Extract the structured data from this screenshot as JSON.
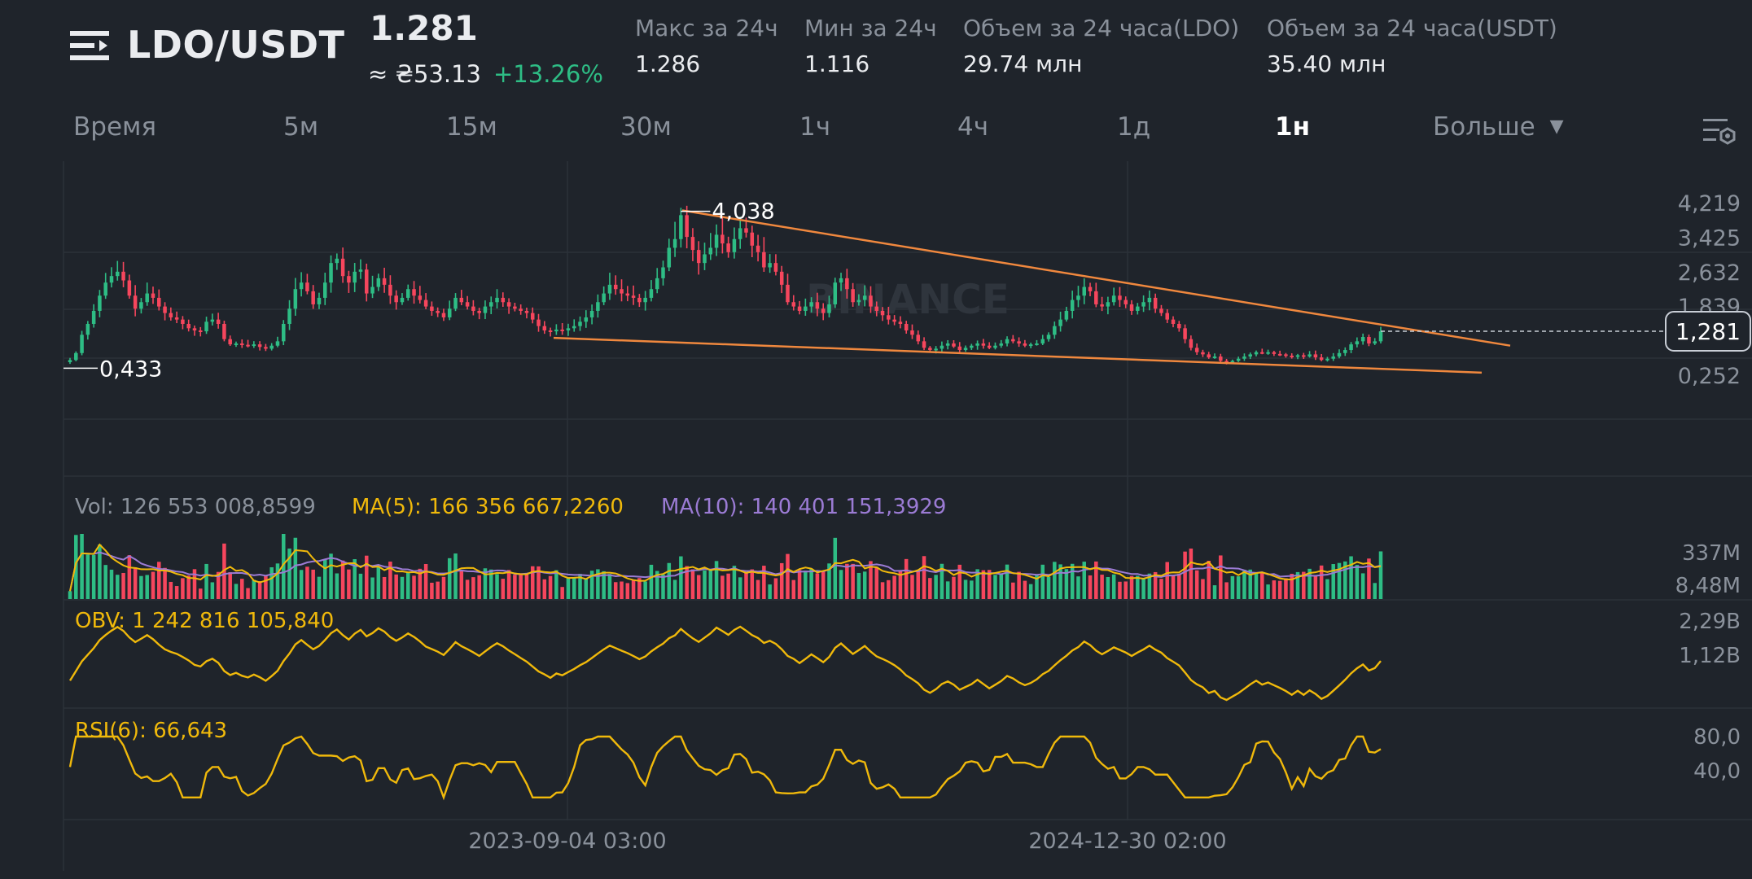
{
  "header": {
    "pair": "LDO/USDT",
    "price": "1.281",
    "fiat_price": "≈ ₴53.13",
    "change": "+13.26%",
    "stats": [
      {
        "label": "Макс за 24ч",
        "value": "1.286"
      },
      {
        "label": "Мин за 24ч",
        "value": "1.116"
      },
      {
        "label": "Объем за 24 часа(LDO)",
        "value": "29.74 млн"
      },
      {
        "label": "Объем за 24 часа(USDT)",
        "value": "35.40 млн"
      }
    ]
  },
  "tabs": {
    "items": [
      "Время",
      "5м",
      "15м",
      "30м",
      "1ч",
      "4ч",
      "1д",
      "1н"
    ],
    "active": "1н",
    "more": "Больше"
  },
  "colors": {
    "up": "#2ebd85",
    "down": "#f6465d",
    "trendline": "#f0883e",
    "ma5": "#f0b90b",
    "ma10": "#9b7bd4",
    "obv": "#f0b90b",
    "rsi": "#f0b90b",
    "background": "#1f242b"
  },
  "chart_data": [
    {
      "type": "candlestick",
      "price_axis_ticks": [
        "4,219",
        "3,425",
        "2,632",
        "1,839",
        "1,281",
        "0,252"
      ],
      "current_price_label": "1,281",
      "max_label": "4,038",
      "min_label": "0,433",
      "watermark": "BINANCE",
      "x_tick_labels": [
        "2023-09-04 03:00",
        "2024-12-30 02:00"
      ],
      "ylim": [
        0.252,
        4.219
      ],
      "trendlines": [
        {
          "name": "upper",
          "from_price": 4.06,
          "to_price": 0.95
        },
        {
          "name": "lower",
          "from_price": 1.13,
          "to_price": 0.33
        }
      ],
      "close": [
        0.62,
        0.78,
        1.2,
        1.45,
        1.75,
        2.1,
        2.4,
        2.55,
        2.65,
        2.45,
        2.1,
        1.8,
        1.95,
        2.15,
        2.05,
        1.85,
        1.7,
        1.6,
        1.55,
        1.45,
        1.35,
        1.3,
        1.28,
        1.5,
        1.55,
        1.45,
        1.1,
        0.98,
        1.0,
        0.97,
        0.96,
        0.98,
        0.92,
        0.88,
        0.95,
        1.05,
        1.45,
        1.8,
        2.25,
        2.4,
        2.2,
        1.9,
        2.05,
        2.4,
        2.85,
        2.95,
        2.55,
        2.4,
        2.65,
        2.7,
        2.15,
        2.3,
        2.5,
        2.35,
        2.1,
        1.95,
        2.05,
        2.25,
        2.1,
        2.0,
        1.85,
        1.75,
        1.7,
        1.6,
        1.8,
        2.05,
        1.95,
        1.85,
        1.75,
        1.7,
        1.85,
        1.95,
        2.05,
        1.95,
        1.85,
        1.8,
        1.75,
        1.7,
        1.55,
        1.4,
        1.3,
        1.28,
        1.32,
        1.3,
        1.35,
        1.4,
        1.5,
        1.6,
        1.75,
        1.95,
        2.15,
        2.35,
        2.25,
        2.15,
        2.1,
        2.05,
        1.95,
        2.05,
        2.25,
        2.5,
        2.75,
        3.2,
        3.4,
        3.95,
        3.45,
        3.15,
        2.85,
        3.05,
        3.2,
        3.5,
        3.3,
        3.1,
        3.4,
        3.65,
        3.55,
        3.25,
        3.1,
        2.75,
        2.85,
        2.65,
        2.35,
        1.95,
        1.85,
        1.75,
        1.85,
        1.95,
        1.8,
        1.7,
        1.9,
        2.4,
        2.5,
        2.25,
        1.95,
        2.0,
        2.1,
        1.85,
        1.75,
        1.65,
        1.55,
        1.5,
        1.45,
        1.3,
        1.2,
        1.05,
        0.9,
        0.85,
        0.88,
        0.95,
        1.0,
        0.93,
        0.85,
        0.9,
        0.95,
        1.0,
        0.95,
        0.9,
        0.95,
        1.0,
        1.1,
        1.05,
        1.0,
        0.95,
        0.98,
        1.0,
        1.1,
        1.2,
        1.4,
        1.55,
        1.75,
        2.0,
        2.1,
        2.3,
        2.2,
        1.9,
        1.85,
        1.95,
        2.1,
        2.0,
        1.9,
        1.75,
        1.85,
        1.95,
        2.05,
        1.8,
        1.7,
        1.55,
        1.45,
        1.35,
        1.1,
        0.9,
        0.8,
        0.75,
        0.68,
        0.7,
        0.6,
        0.57,
        0.6,
        0.65,
        0.7,
        0.75,
        0.8,
        0.78,
        0.8,
        0.76,
        0.75,
        0.72,
        0.7,
        0.73,
        0.7,
        0.75,
        0.68,
        0.62,
        0.65,
        0.7,
        0.78,
        0.85,
        0.98,
        1.05,
        1.15,
        1.0,
        1.05,
        1.28
      ]
    },
    {
      "type": "bar",
      "name": "Volume",
      "title": "Vol: 126 553 008,8599",
      "ma_labels": [
        "MA(5): 166 356 667,2260",
        "MA(10): 140 401 151,3929"
      ],
      "axis_ticks": [
        "337M",
        "8,48M"
      ],
      "ylim": [
        0,
        400
      ]
    },
    {
      "type": "line",
      "name": "OBV",
      "title": "OBV: 1 242 816 105,840",
      "axis_ticks": [
        "2,29B",
        "1,12B"
      ],
      "ylim": [
        0,
        2.29
      ]
    },
    {
      "type": "line",
      "name": "RSI(6)",
      "title": "RSI(6): 66,643",
      "axis_ticks": [
        "80,0",
        "40,0"
      ],
      "ylim": [
        0,
        100
      ]
    }
  ]
}
